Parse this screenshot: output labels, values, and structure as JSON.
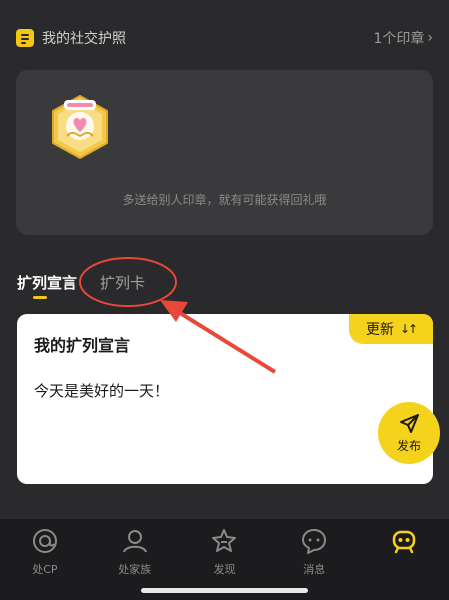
{
  "passport": {
    "title": "我的社交护照",
    "stamp_count": "1个印章",
    "hint": "多送给别人印章，就有可能获得回礼哦"
  },
  "tabs": [
    {
      "label": "扩列宣言",
      "active": true
    },
    {
      "label": "扩列卡",
      "active": false
    }
  ],
  "declaration_card": {
    "title": "我的扩列宣言",
    "update_label": "更新",
    "text": "今天是美好的一天！"
  },
  "publish": {
    "label": "发布"
  },
  "bottom_nav": [
    {
      "label": "处CP",
      "icon": "at-icon"
    },
    {
      "label": "处家族",
      "icon": "people-icon"
    },
    {
      "label": "发现",
      "icon": "star-icon"
    },
    {
      "label": "消息",
      "icon": "chat-icon"
    },
    {
      "label": "",
      "icon": "profile-face-icon",
      "active": true
    }
  ],
  "colors": {
    "accent": "#f5d21c",
    "annotation": "#e8483a",
    "background": "#2a2a2c",
    "card": "#3a3a3c"
  }
}
